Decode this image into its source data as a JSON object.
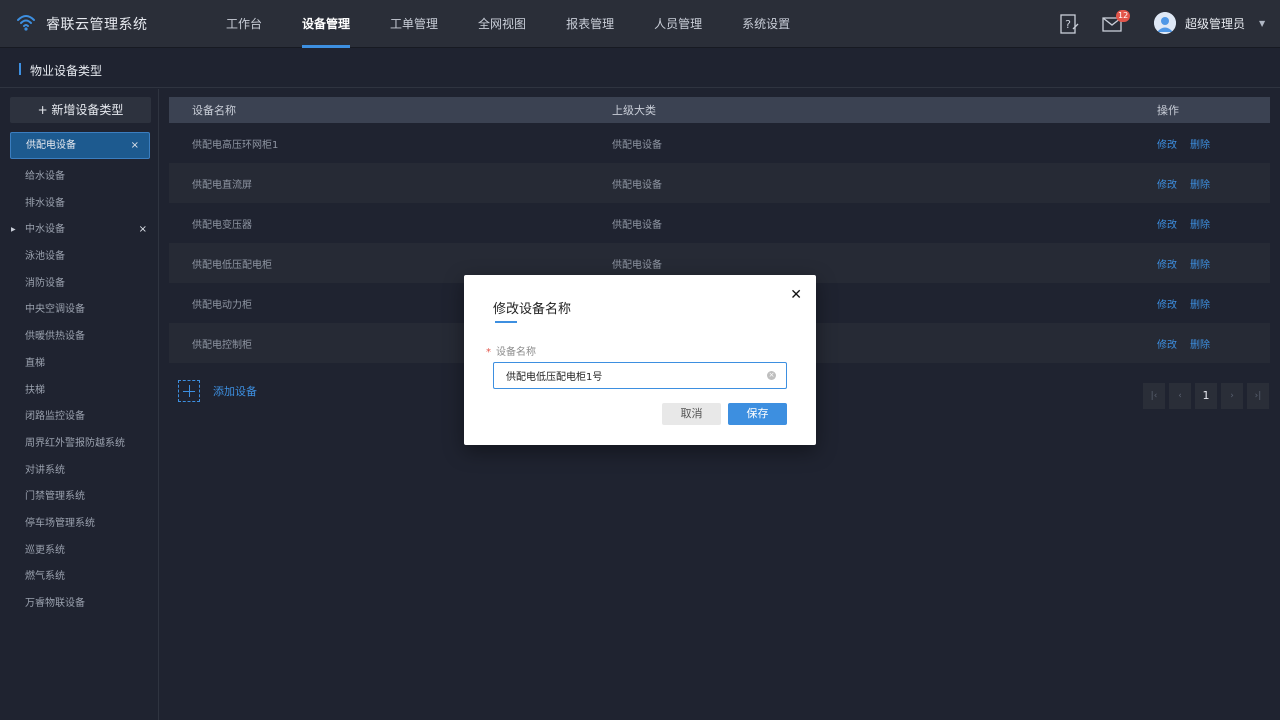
{
  "app": {
    "title": "睿联云管理系统"
  },
  "nav": {
    "items": [
      "工作台",
      "设备管理",
      "工单管理",
      "全网视图",
      "报表管理",
      "人员管理",
      "系统设置"
    ],
    "active_index": 1
  },
  "header": {
    "help_icon": "help-doc-icon",
    "mail_icon": "mail-icon",
    "mail_badge": "12",
    "user_name": "超级管理员",
    "user_caret": "▼"
  },
  "breadcrumb": {
    "title": "物业设备类型"
  },
  "sidebar": {
    "add_button": "+ 新增设备类型",
    "items": [
      {
        "label": "供配电设备",
        "active": true,
        "closable": true
      },
      {
        "label": "给水设备"
      },
      {
        "label": "排水设备"
      },
      {
        "label": "中水设备",
        "expandable": true,
        "closable": true
      },
      {
        "label": "泳池设备"
      },
      {
        "label": "消防设备"
      },
      {
        "label": "中央空调设备"
      },
      {
        "label": "供暖供热设备"
      },
      {
        "label": "直梯"
      },
      {
        "label": "扶梯"
      },
      {
        "label": "闭路监控设备"
      },
      {
        "label": "周界红外警报防越系统"
      },
      {
        "label": "对讲系统"
      },
      {
        "label": "门禁管理系统"
      },
      {
        "label": "停车场管理系统"
      },
      {
        "label": "巡更系统"
      },
      {
        "label": "燃气系统"
      },
      {
        "label": "万睿物联设备"
      }
    ],
    "close_glyph": "×",
    "arrow_glyph": "▶"
  },
  "table": {
    "headers": [
      "设备名称",
      "上级大类",
      "操作"
    ],
    "rows": [
      {
        "name": "供配电高压环网柜1",
        "parent": "供配电设备"
      },
      {
        "name": "供配电直流屏",
        "parent": "供配电设备"
      },
      {
        "name": "供配电变压器",
        "parent": "供配电设备"
      },
      {
        "name": "供配电低压配电柜",
        "parent": "供配电设备"
      },
      {
        "name": "供配电动力柜",
        "parent": ""
      },
      {
        "name": "供配电控制柜",
        "parent": ""
      }
    ],
    "edit_label": "修改",
    "delete_label": "删除",
    "add_label": "添加设备"
  },
  "pagination": {
    "first": "|‹",
    "prev": "‹",
    "current": "1",
    "next": "›",
    "last": "›|"
  },
  "dialog": {
    "title": "修改设备名称",
    "field_label": "设备名称",
    "required_mark": "*",
    "field_value": "供配电低压配电柜1号",
    "clear_glyph": "×",
    "close_glyph": "✕",
    "cancel_label": "取消",
    "save_label": "保存"
  },
  "colors": {
    "accent": "#3d8fe0",
    "background": "#1f2330",
    "topbar": "#2a2e38",
    "badge": "#e2554a"
  }
}
